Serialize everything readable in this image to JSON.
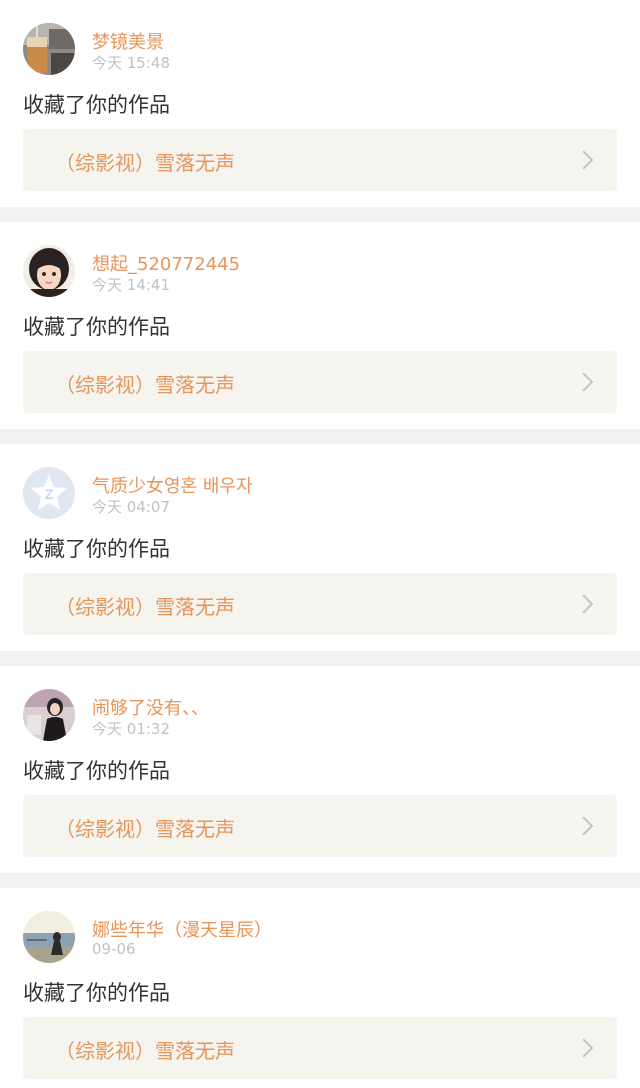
{
  "notifications": [
    {
      "username": "梦镜美景",
      "time": "今天 15:48",
      "action": "收藏了你的作品",
      "work_title": "（综影视）雪落无声",
      "avatar_icon": "drink-photo-avatar-icon"
    },
    {
      "username": "想起_520772445",
      "time": "今天 14:41",
      "action": "收藏了你的作品",
      "work_title": "（综影视）雪落无声",
      "avatar_icon": "cartoon-girl-avatar-icon"
    },
    {
      "username": "气质少女영혼 배우자",
      "time": "今天 04:07",
      "action": "收藏了你的作品",
      "work_title": "（综影视）雪落无声",
      "avatar_icon": "default-star-avatar-icon"
    },
    {
      "username": "闹够了没有、、",
      "time": "今天 01:32",
      "action": "收藏了你的作品",
      "work_title": "（综影视）雪落无声",
      "avatar_icon": "girl-photo-avatar-icon"
    },
    {
      "username": "娜些年华（漫天星辰）",
      "time": "09-06",
      "action": "收藏了你的作品",
      "work_title": "（综影视）雪落无声",
      "avatar_icon": "seaside-photo-avatar-icon"
    }
  ],
  "colors": {
    "accent": "#e8955a",
    "time_gray": "#c2c2c2",
    "box_bg": "#f5f4ee",
    "separator": "#f2f2f2"
  }
}
